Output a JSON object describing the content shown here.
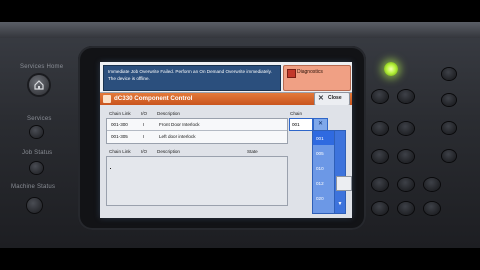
{
  "hardware": {
    "services_home_label": "Services Home",
    "services_label": "Services",
    "job_status_label": "Job Status",
    "machine_status_label": "Machine Status",
    "power_led_color": "#b6f23a"
  },
  "message": {
    "text": "Immediate Job Overwrite Failed.  Perform an On Demand Overwrite immediately. The device is offline."
  },
  "diagnostics": {
    "label": "Diagnostics",
    "icon": "diagnostics-icon"
  },
  "window": {
    "title": "dC330 Component Control",
    "close_label": "Close"
  },
  "selected_table": {
    "headers": {
      "chain_link": "Chain Link",
      "io": "I/O",
      "description": "Description"
    },
    "rows": [
      {
        "chain_link": "001-300",
        "io": "I",
        "description": "Front Door Interlock"
      },
      {
        "chain_link": "001-305",
        "io": "I",
        "description": "Left door interlock"
      }
    ]
  },
  "status_table": {
    "headers": {
      "chain_link": "Chain Link",
      "io": "I/O",
      "description": "Description",
      "state": "State"
    }
  },
  "chain": {
    "label": "Chain",
    "selected": "001",
    "options": [
      "001",
      "005",
      "010",
      "012",
      "020"
    ]
  }
}
